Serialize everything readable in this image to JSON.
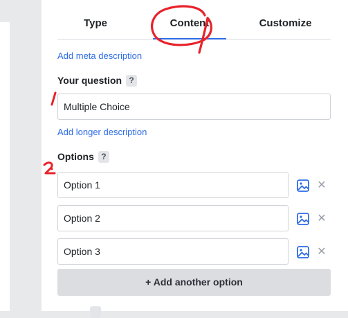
{
  "tabs": [
    {
      "label": "Type"
    },
    {
      "label": "Content"
    },
    {
      "label": "Customize"
    }
  ],
  "meta_link": "Add meta description",
  "question": {
    "label": "Your question",
    "help": "?",
    "value": "Multiple Choice"
  },
  "longer_description_link": "Add longer description",
  "options": {
    "label": "Options",
    "help": "?",
    "items": [
      {
        "value": "Option 1"
      },
      {
        "value": "Option 2"
      },
      {
        "value": "Option 3"
      }
    ],
    "remove_glyph": "✕",
    "image_icon": "image-icon",
    "add_label": "+ Add another option"
  },
  "colors": {
    "accent": "#2d6be4",
    "annotation": "#e8222a"
  }
}
